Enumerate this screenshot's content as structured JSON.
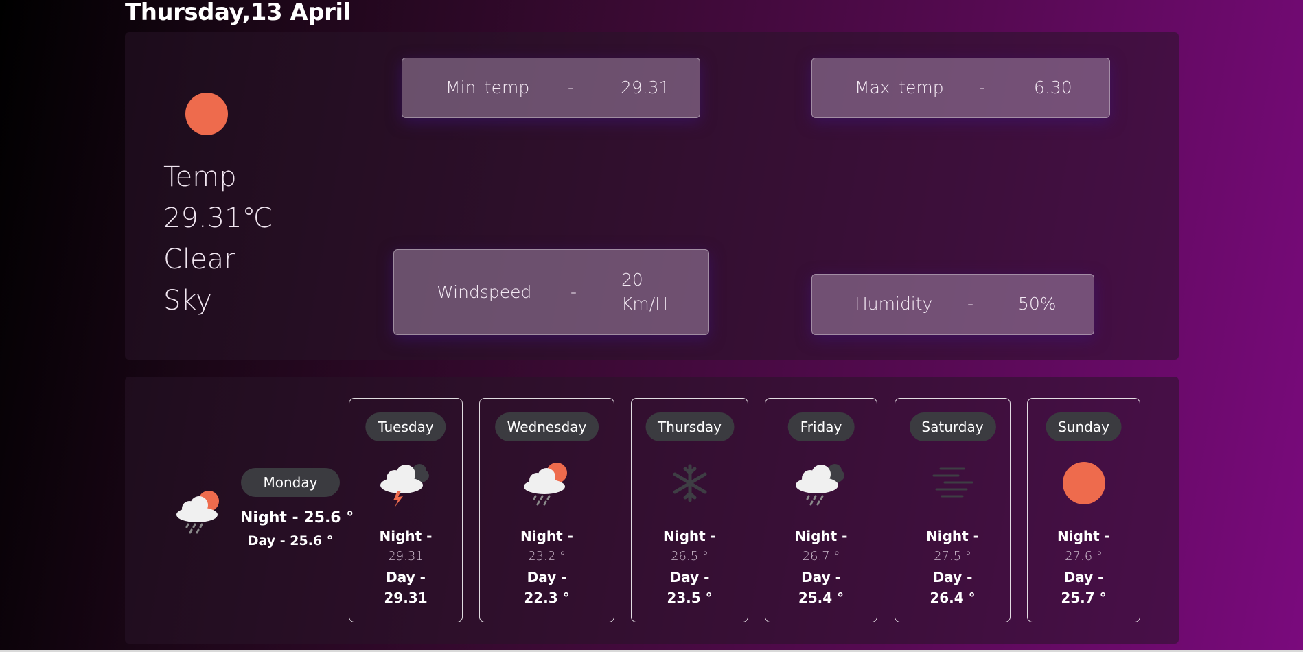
{
  "header": {
    "date": "Thursday,13 April"
  },
  "current": {
    "condition_icon": "sun-icon",
    "label": "Temp",
    "temperature": "29.31℃",
    "condition_line1": "Clear",
    "condition_line2": "Sky",
    "stats": {
      "min": {
        "label": "Min_temp",
        "sep": "-",
        "value": "29.31"
      },
      "max": {
        "label": "Max_temp",
        "sep": "-",
        "value": "6.30"
      },
      "wind": {
        "label": "Windspeed",
        "sep": "-",
        "value_line1": "20",
        "value_line2": "Km/H"
      },
      "humidity": {
        "label": "Humidity",
        "sep": "-",
        "value": "50%"
      }
    }
  },
  "today": {
    "icon": "rain-cloud-sun-icon",
    "name": "Monday",
    "night": "Night - 25.6 °",
    "day": "Day - 25.6 °"
  },
  "forecast": [
    {
      "name": "Tuesday",
      "icon": "thunderstorm-icon",
      "night_label": "Night -",
      "night": "29.31",
      "day_label": "Day -",
      "day": "29.31"
    },
    {
      "name": "Wednesday",
      "icon": "rain-cloud-sun-icon",
      "night_label": "Night -",
      "night": "23.2 °",
      "day_label": "Day -",
      "day": "22.3 °"
    },
    {
      "name": "Thursday",
      "icon": "snowflake-icon",
      "night_label": "Night -",
      "night": "26.5 °",
      "day_label": "Day -",
      "day": "23.5 °"
    },
    {
      "name": "Friday",
      "icon": "rain-cloud-icon",
      "night_label": "Night -",
      "night": "26.7 °",
      "day_label": "Day -",
      "day": "25.4 °"
    },
    {
      "name": "Saturday",
      "icon": "fog-icon",
      "night_label": "Night -",
      "night": "27.5 °",
      "day_label": "Day -",
      "day": "26.4 °"
    },
    {
      "name": "Sunday",
      "icon": "sun-icon",
      "night_label": "Night -",
      "night": "27.6 °",
      "day_label": "Day -",
      "day": "25.7 °"
    }
  ],
  "colors": {
    "sun": "#ee6b4d",
    "pill": "#3b3b40",
    "card_border": "#ffffff",
    "stat_box": "#9d879f"
  }
}
